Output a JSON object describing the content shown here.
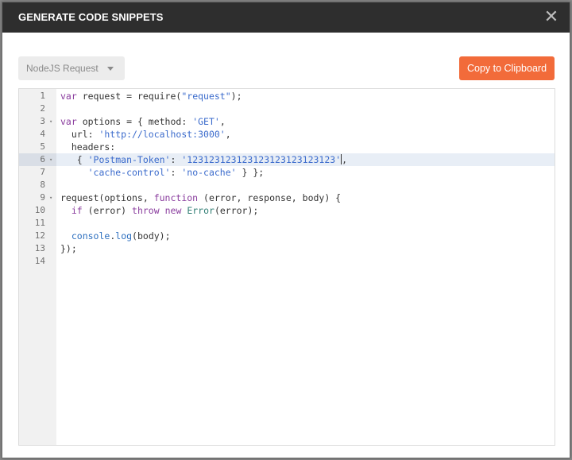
{
  "dialog": {
    "title": "GENERATE CODE SNIPPETS",
    "close_symbol": "✕"
  },
  "language_select": {
    "selected": "NodeJS Request"
  },
  "copy_button": {
    "label": "Copy to Clipboard"
  },
  "colors": {
    "header_bg": "#2e2e2e",
    "accent": "#f26b3a",
    "keyword": "#8a3d9e",
    "string": "#3b6bcc"
  },
  "editor": {
    "active_line": 6,
    "lines": [
      {
        "n": "1",
        "fold": false,
        "tokens": [
          {
            "t": "kw",
            "v": "var"
          },
          {
            "t": "pl",
            "v": " request = require("
          },
          {
            "t": "str",
            "v": "\"request\""
          },
          {
            "t": "pl",
            "v": ");"
          }
        ]
      },
      {
        "n": "2",
        "fold": false,
        "tokens": []
      },
      {
        "n": "3",
        "fold": true,
        "tokens": [
          {
            "t": "kw",
            "v": "var"
          },
          {
            "t": "pl",
            "v": " options = { method: "
          },
          {
            "t": "str",
            "v": "'GET'"
          },
          {
            "t": "pl",
            "v": ","
          }
        ]
      },
      {
        "n": "4",
        "fold": false,
        "tokens": [
          {
            "t": "pl",
            "v": "  url: "
          },
          {
            "t": "str",
            "v": "'http://localhost:3000'"
          },
          {
            "t": "pl",
            "v": ","
          }
        ]
      },
      {
        "n": "5",
        "fold": false,
        "tokens": [
          {
            "t": "pl",
            "v": "  headers:"
          }
        ]
      },
      {
        "n": "6",
        "fold": true,
        "tokens": [
          {
            "t": "pl",
            "v": "   { "
          },
          {
            "t": "str",
            "v": "'Postman-Token'"
          },
          {
            "t": "pl",
            "v": ": "
          },
          {
            "t": "str",
            "v": "'123123123123123123123123123'"
          },
          {
            "t": "cursor",
            "v": ""
          },
          {
            "t": "pl",
            "v": ","
          }
        ]
      },
      {
        "n": "7",
        "fold": false,
        "tokens": [
          {
            "t": "pl",
            "v": "     "
          },
          {
            "t": "str",
            "v": "'cache-control'"
          },
          {
            "t": "pl",
            "v": ": "
          },
          {
            "t": "str",
            "v": "'no-cache'"
          },
          {
            "t": "pl",
            "v": " } };"
          }
        ]
      },
      {
        "n": "8",
        "fold": false,
        "tokens": []
      },
      {
        "n": "9",
        "fold": true,
        "tokens": [
          {
            "t": "pl",
            "v": "request(options, "
          },
          {
            "t": "kw",
            "v": "function"
          },
          {
            "t": "pl",
            "v": " (error, response, body) {"
          }
        ]
      },
      {
        "n": "10",
        "fold": false,
        "tokens": [
          {
            "t": "pl",
            "v": "  "
          },
          {
            "t": "kw",
            "v": "if"
          },
          {
            "t": "pl",
            "v": " (error) "
          },
          {
            "t": "kw",
            "v": "throw"
          },
          {
            "t": "pl",
            "v": " "
          },
          {
            "t": "kw",
            "v": "new"
          },
          {
            "t": "pl",
            "v": " "
          },
          {
            "t": "cls",
            "v": "Error"
          },
          {
            "t": "pl",
            "v": "(error);"
          }
        ]
      },
      {
        "n": "11",
        "fold": false,
        "tokens": []
      },
      {
        "n": "12",
        "fold": false,
        "tokens": [
          {
            "t": "pl",
            "v": "  "
          },
          {
            "t": "fn",
            "v": "console"
          },
          {
            "t": "pl",
            "v": "."
          },
          {
            "t": "fn",
            "v": "log"
          },
          {
            "t": "pl",
            "v": "(body);"
          }
        ]
      },
      {
        "n": "13",
        "fold": false,
        "tokens": [
          {
            "t": "pl",
            "v": "});"
          }
        ]
      },
      {
        "n": "14",
        "fold": false,
        "tokens": []
      }
    ]
  }
}
